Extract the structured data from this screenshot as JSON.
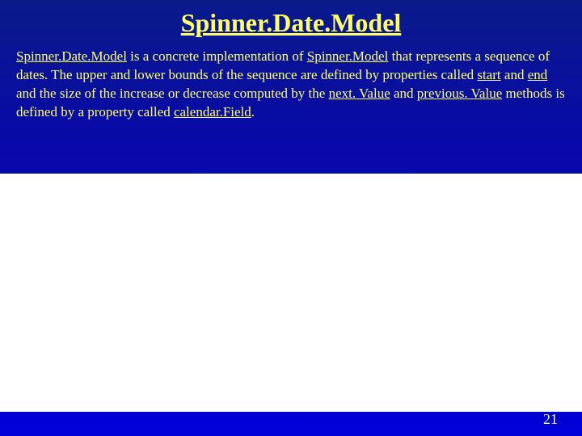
{
  "slide": {
    "title": "Spinner.Date.Model",
    "body": {
      "t1": "Spinner.Date.Model",
      "t2": " is a concrete implementation of ",
      "t3": "Spinner.Model",
      "t4": " that represents a sequence of dates. The upper and lower bounds of the sequence are defined by properties called ",
      "t5": "start",
      "t6": " and ",
      "t7": "end",
      "t8": " and the size of the increase or decrease computed by the ",
      "t9": "next. Value",
      "t10": " and ",
      "t11": "previous. Value",
      "t12": " methods is defined by a property called ",
      "t13": "calendar.Field",
      "t14": "."
    },
    "page_number": "21"
  }
}
